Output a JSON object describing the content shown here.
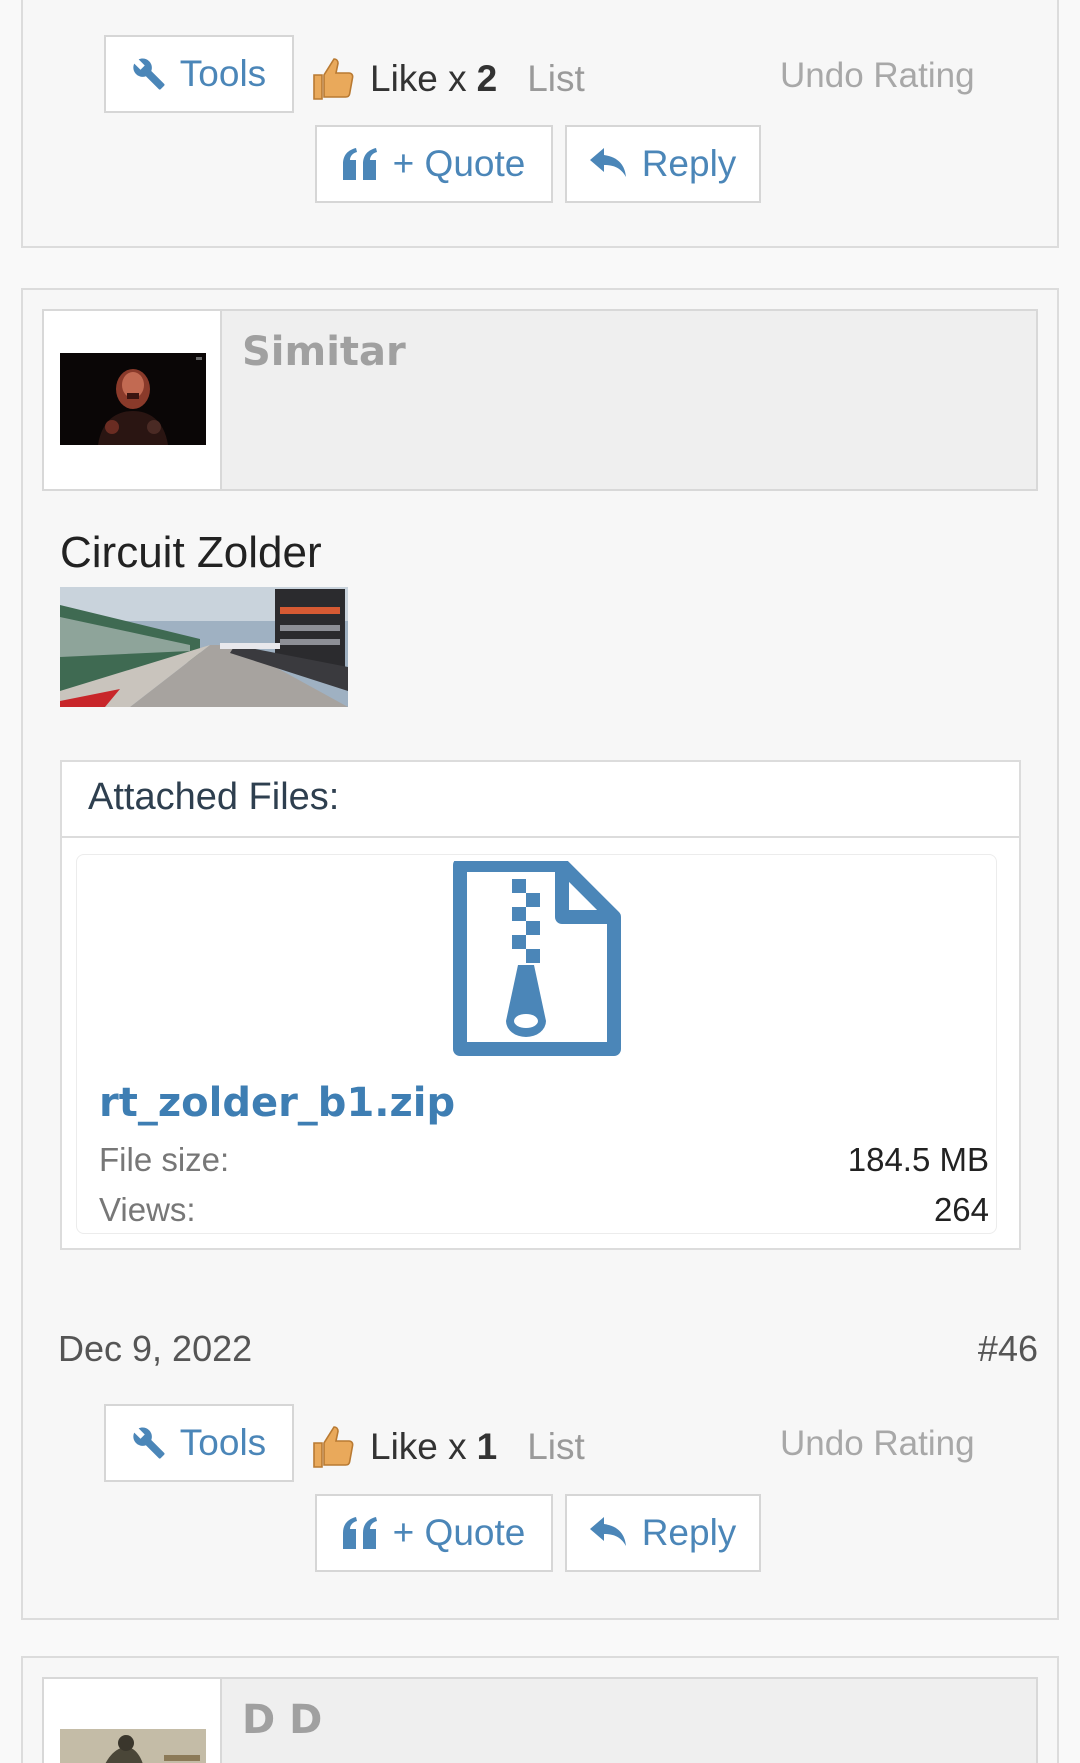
{
  "prev_post": {
    "tools_label": "Tools",
    "like_label": "Like x",
    "like_count": "2",
    "list_label": "List",
    "undo_rating_label": "Undo Rating",
    "quote_label": "+ Quote",
    "reply_label": "Reply"
  },
  "post": {
    "username": "Simitar",
    "title": "Circuit Zolder",
    "attachments_title": "Attached Files:",
    "file": {
      "name": "rt_zolder_b1.zip",
      "size_label": "File size:",
      "size_value": "184.5 MB",
      "views_label": "Views:",
      "views_value": "264"
    },
    "date": "Dec 9, 2022",
    "number": "#46",
    "tools_label": "Tools",
    "like_label": "Like x",
    "like_count": "1",
    "list_label": "List",
    "undo_rating_label": "Undo Rating",
    "quote_label": "+ Quote",
    "reply_label": "Reply"
  },
  "next_post": {
    "username": "D D"
  },
  "colors": {
    "accent": "#4b86b8",
    "link": "#3e7eb3",
    "border": "#dcdcdc"
  },
  "icons": [
    "wrench-icon",
    "thumbs-up-icon",
    "quote-icon",
    "reply-icon",
    "zip-file-icon"
  ]
}
